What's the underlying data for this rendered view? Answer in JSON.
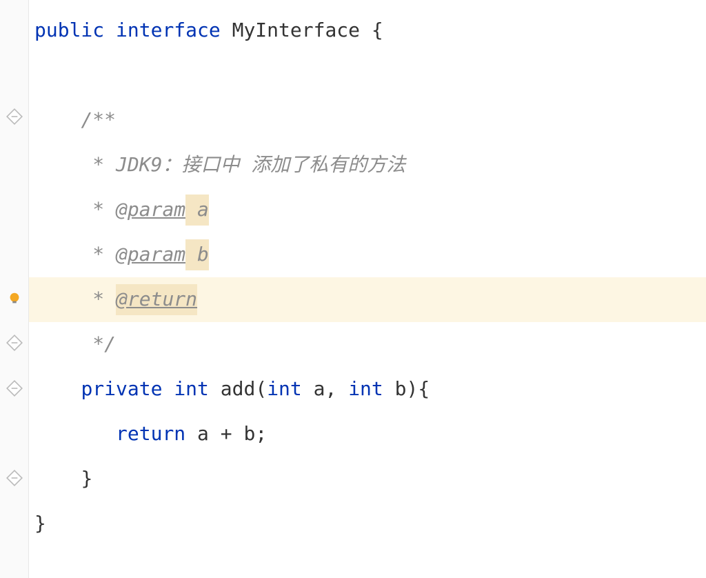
{
  "code": {
    "line1": {
      "public": "public",
      "interface": "interface",
      "className": " MyInterface ",
      "brace": "{"
    },
    "line3": {
      "comment": "/**"
    },
    "line4": {
      "star": " * ",
      "text": "JDK9：接口中 添加了私有的方法"
    },
    "line5": {
      "star": " * ",
      "tag": "@param",
      "param": " a"
    },
    "line6": {
      "star": " * ",
      "tag": "@param",
      "param": " b"
    },
    "line7": {
      "star": " * ",
      "tag": "@return"
    },
    "line8": {
      "comment": " */"
    },
    "line9": {
      "private": "private",
      "int": "int",
      "method": " add",
      "paren1": "(",
      "int2": "int",
      "a": " a, ",
      "int3": "int",
      "b": " b)",
      "brace": "{"
    },
    "line10": {
      "return": "return",
      "expr": " a + b;"
    },
    "line11": {
      "brace": "}"
    },
    "line12": {
      "brace": "}"
    }
  }
}
